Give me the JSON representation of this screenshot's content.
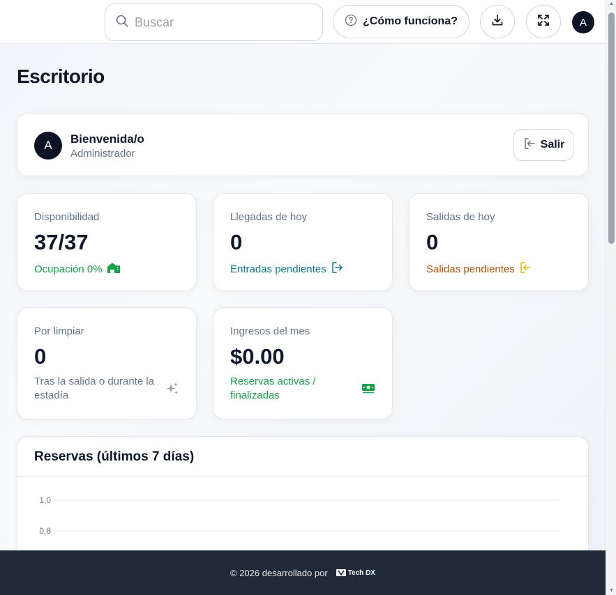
{
  "header": {
    "search_placeholder": "Buscar",
    "help_label": "¿Cómo funciona?",
    "user_initial": "A"
  },
  "page": {
    "title": "Escritorio"
  },
  "welcome": {
    "avatar_initial": "A",
    "title": "Bienvenida/o",
    "role": "Administrador",
    "logout_label": "Salir"
  },
  "stats": [
    {
      "label": "Disponibilidad",
      "value": "37/37",
      "note": "Ocupación 0%",
      "note_color": "#16a34a",
      "icon": "house-icon"
    },
    {
      "label": "Llegadas de hoy",
      "value": "0",
      "note": "Entradas pendientes",
      "note_color": "#0e7490",
      "icon": "arrow-right-from-bracket-icon"
    },
    {
      "label": "Salidas de hoy",
      "value": "0",
      "note": "Salidas pendientes",
      "note_color": "#b45309",
      "icon": "arrow-left-into-bracket-icon"
    },
    {
      "label": "Por limpiar",
      "value": "0",
      "note": "Tras la salida o durante la estadía",
      "note_color": "#64748b",
      "icon": "sparkles-icon"
    },
    {
      "label": "Ingresos del mes",
      "value": "$0.00",
      "note": "Reservas activas / finalizadas",
      "note_color": "#16a34a",
      "icon": "money-icon"
    }
  ],
  "chart_data": {
    "type": "bar",
    "title": "Reservas (últimos 7 días)",
    "y_tick_labels": [
      "1,0",
      "0,8"
    ],
    "grid": true
  },
  "footer": {
    "text": "© 2026 desarrollado por",
    "logo_text": "Tech DX"
  }
}
